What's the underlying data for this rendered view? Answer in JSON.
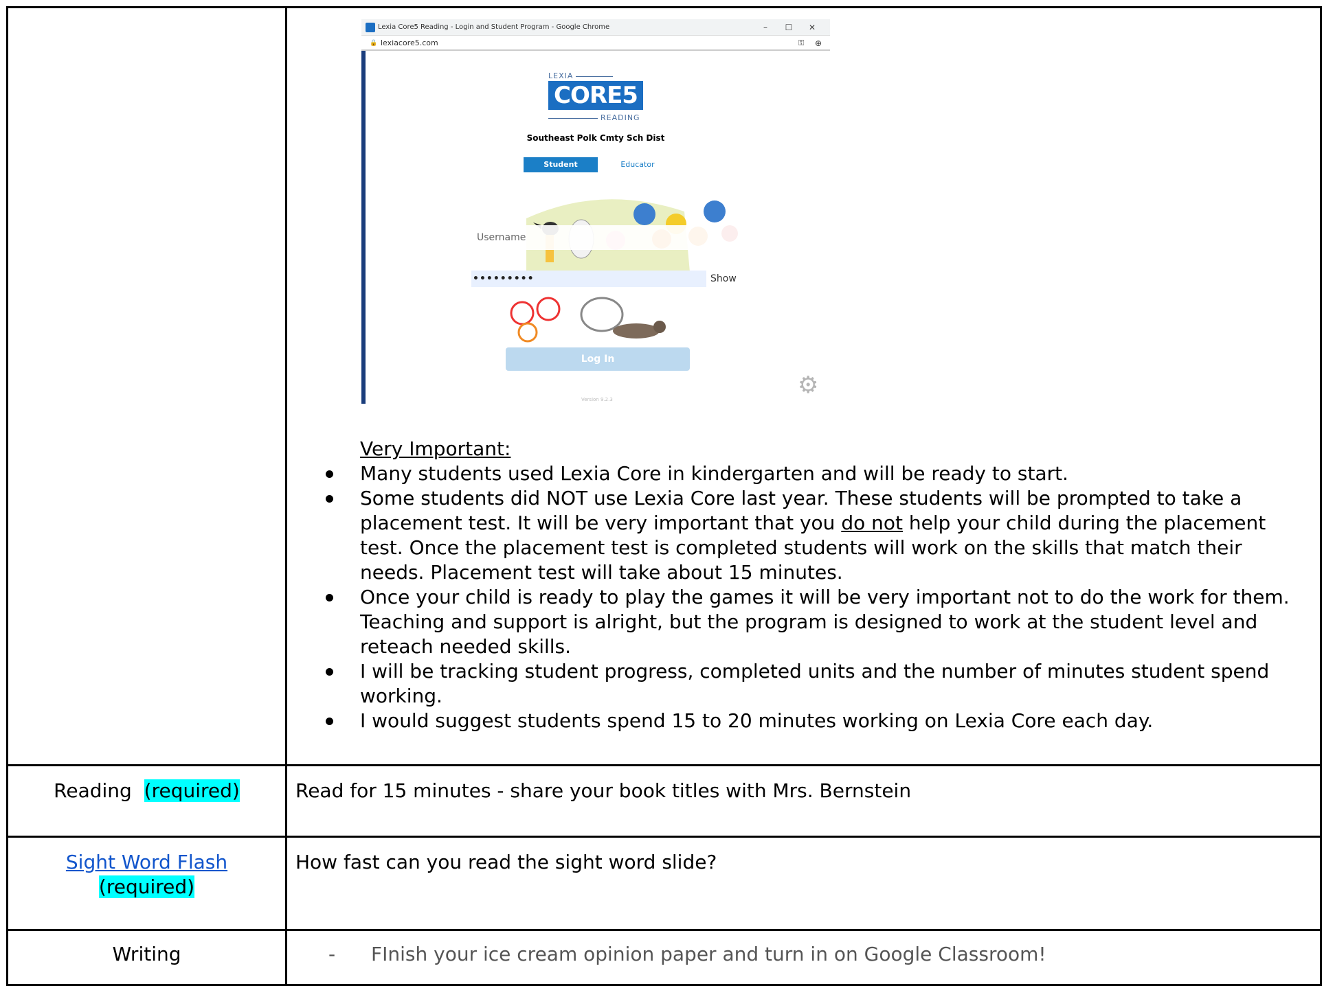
{
  "screenshot": {
    "window_title": "Lexia Core5 Reading - Login and Student Program - Google Chrome",
    "url": "lexiacore5.com",
    "win_min": "–",
    "win_max": "☐",
    "win_close": "✕",
    "logo_small": "LEXIA",
    "logo_main": "CORE5",
    "logo_sub": "READING",
    "district": "Southeast Polk Cmty Sch Dist",
    "tab_student": "Student",
    "tab_educator": "Educator",
    "username_placeholder": "Username",
    "password_value": "•••••••••",
    "show_label": "Show",
    "login_label": "Log In",
    "version": "Version 9.2.3"
  },
  "notes": {
    "heading": "Very Important:",
    "bullets": {
      "b1": "Many students used Lexia Core in kindergarten and will be ready to start.",
      "b2_pre": "Some students did NOT use Lexia Core last year. These students will be prompted to take a placement test. It will be very important that you ",
      "b2_u": "do not",
      "b2_post": " help your child during the placement test. Once the placement test is completed students will work on the skills that match their needs. Placement test will take about 15 minutes.",
      "b3": "Once your child is ready to play the games it will be very important not to do the work for them. Teaching and support is alright, but the program is designed to work at the student level and reteach needed skills.",
      "b4": "I will be tracking student progress, completed units and the number of minutes student spend working.",
      "b5": "I would suggest students spend 15 to 20 minutes working on Lexia Core each day."
    }
  },
  "rows": {
    "reading": {
      "label": "Reading",
      "tag": "(required)",
      "text": "Read for 15 minutes - share your book titles with Mrs. Bernstein"
    },
    "sight": {
      "label": "Sight Word Flash",
      "tag": "(required)",
      "text": "How fast can you read the sight word slide?"
    },
    "writing": {
      "label": "Writing",
      "dash": "-",
      "text": "FInish your ice cream opinion paper and turn in on Google Classroom!"
    }
  },
  "colors": {
    "highlight": "#00ffff",
    "link": "#1155cc",
    "lexia_blue": "#1b6ec2"
  }
}
